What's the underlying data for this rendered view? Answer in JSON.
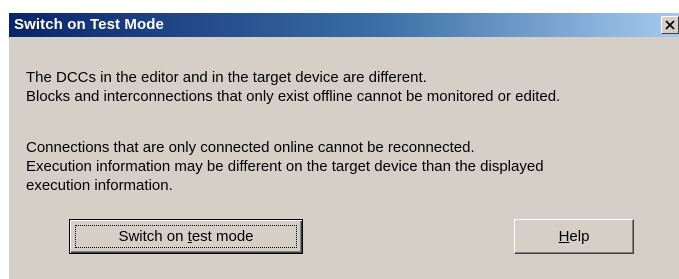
{
  "window": {
    "title": "Switch on Test Mode",
    "close_icon": "close-icon"
  },
  "messages": {
    "group1": [
      "The DCCs in the editor and in the target device are different.",
      "Blocks and interconnections that only exist offline cannot be monitored or edited."
    ],
    "group2": [
      "Connections that are only connected online cannot be reconnected.",
      "Execution information may be different on the target device than the displayed",
      "execution information."
    ]
  },
  "buttons": {
    "switch_on": {
      "label_before": "Switch on ",
      "label_hotkey": "t",
      "label_after": "est mode",
      "is_default": true
    },
    "help": {
      "label_before": "",
      "label_hotkey": "H",
      "label_after": "elp"
    }
  },
  "colors": {
    "dialog_face": "#d4d0c8",
    "title_gradient_start": "#0a246a",
    "title_gradient_end": "#a6caf0",
    "title_text": "#ffffff"
  }
}
